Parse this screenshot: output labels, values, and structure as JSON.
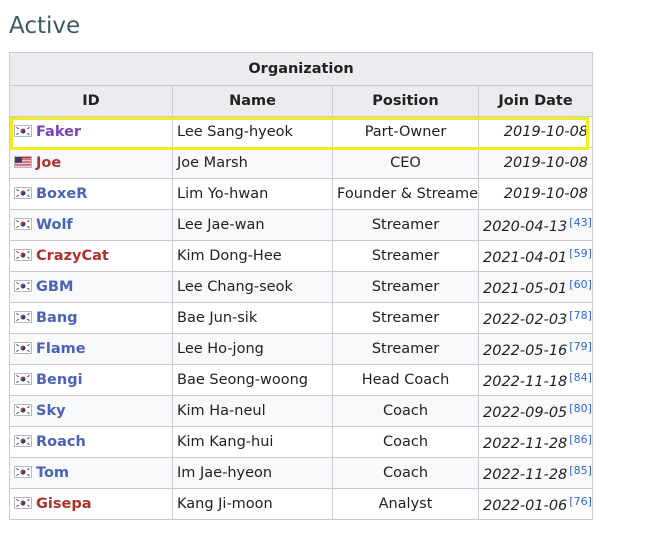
{
  "section_title": "Active",
  "table": {
    "group_header": "Organization",
    "columns": {
      "id": "ID",
      "name": "Name",
      "position": "Position",
      "join_date": "Join Date"
    },
    "rows": [
      {
        "flag": "kr-flag-icon",
        "id": "Faker",
        "link_color": "visited",
        "name": "Lee Sang-hyeok",
        "position": "Part-Owner",
        "join_date": "2019-10-08",
        "ref": "",
        "highlighted": true
      },
      {
        "flag": "us-flag-icon",
        "id": "Joe",
        "link_color": "red",
        "name": "Joe Marsh",
        "position": "CEO",
        "join_date": "2019-10-08",
        "ref": ""
      },
      {
        "flag": "kr-flag-icon",
        "id": "BoxeR",
        "link_color": "blue",
        "name": "Lim Yo-hwan",
        "position": "Founder & Streamer",
        "join_date": "2019-10-08",
        "ref": ""
      },
      {
        "flag": "kr-flag-icon",
        "id": "Wolf",
        "link_color": "blue",
        "name": "Lee Jae-wan",
        "position": "Streamer",
        "join_date": "2020-04-13",
        "ref": "[43]"
      },
      {
        "flag": "kr-flag-icon",
        "id": "CrazyCat",
        "link_color": "red",
        "name": "Kim Dong-Hee",
        "position": "Streamer",
        "join_date": "2021-04-01",
        "ref": "[59]"
      },
      {
        "flag": "kr-flag-icon",
        "id": "GBM",
        "link_color": "blue",
        "name": "Lee Chang-seok",
        "position": "Streamer",
        "join_date": "2021-05-01",
        "ref": "[60]"
      },
      {
        "flag": "kr-flag-icon",
        "id": "Bang",
        "link_color": "blue",
        "name": "Bae Jun-sik",
        "position": "Streamer",
        "join_date": "2022-02-03",
        "ref": "[78]"
      },
      {
        "flag": "kr-flag-icon",
        "id": "Flame",
        "link_color": "blue",
        "name": "Lee Ho-jong",
        "position": "Streamer",
        "join_date": "2022-05-16",
        "ref": "[79]"
      },
      {
        "flag": "kr-flag-icon",
        "id": "Bengi",
        "link_color": "blue",
        "name": "Bae Seong-woong",
        "position": "Head Coach",
        "join_date": "2022-11-18",
        "ref": "[84]"
      },
      {
        "flag": "kr-flag-icon",
        "id": "Sky",
        "link_color": "blue",
        "name": "Kim Ha-neul",
        "position": "Coach",
        "join_date": "2022-09-05",
        "ref": "[80]"
      },
      {
        "flag": "kr-flag-icon",
        "id": "Roach",
        "link_color": "blue",
        "name": "Kim Kang-hui",
        "position": "Coach",
        "join_date": "2022-11-28",
        "ref": "[86]"
      },
      {
        "flag": "kr-flag-icon",
        "id": "Tom",
        "link_color": "blue",
        "name": "Im Jae-hyeon",
        "position": "Coach",
        "join_date": "2022-11-28",
        "ref": "[85]"
      },
      {
        "flag": "kr-flag-icon",
        "id": "Gisepa",
        "link_color": "red",
        "name": "Kang Ji-moon",
        "position": "Analyst",
        "join_date": "2022-01-06",
        "ref": "[76]"
      }
    ]
  },
  "colors": {
    "link_blue": "#4a62b8",
    "link_red": "#b0302c",
    "link_visited": "#7b44b5",
    "highlight": "#f2ee1e",
    "title": "#3d5a66"
  }
}
